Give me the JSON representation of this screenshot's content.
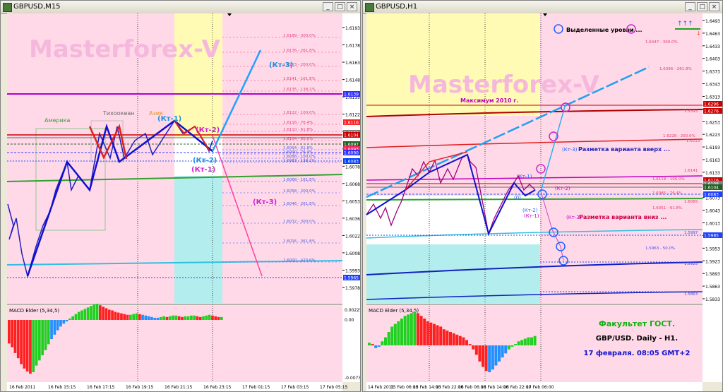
{
  "left": {
    "title": "GBPUSD,M15",
    "watermark": "Masterforex-V",
    "price_ticks": [
      "1.6193",
      "1.6178",
      "1.6163",
      "1.6148",
      "1.6135",
      "1.6122",
      "1.6108",
      "1.6093",
      "1.6078",
      "1.6068",
      "1.6053",
      "1.6036",
      "1.6022",
      "1.6008",
      "1.5993",
      "1.5978"
    ],
    "price_tags": [
      {
        "text": "1.6139",
        "color": "#3030ff"
      },
      {
        "text": "1.6116",
        "color": "#ff2020"
      },
      {
        "text": "1.6106",
        "color": "#808080"
      },
      {
        "text": "1.6104",
        "color": "#cc0000"
      },
      {
        "text": "1.6097",
        "color": "#206020"
      },
      {
        "text": "1.6093",
        "color": "#ff2060"
      },
      {
        "text": "1.6090",
        "color": "#3030ff"
      },
      {
        "text": "1.6083",
        "color": "#0040ff"
      },
      {
        "text": "1.5965",
        "color": "#2040ff"
      }
    ],
    "fib_labels": [
      "1.6189 - 300.0%",
      "1.6176 - 261.8%",
      "1.6163 - 200.0%",
      "1.6141 - 161.8%",
      "1.6135 - 138.2%",
      "1.6122 - 100.0%",
      "1.6116 - 76.4%",
      "1.6110 - 61.8%",
      "1.6104 - 50.0%",
      "1.6094 - 61.8%",
      "1.6090 - 76.4%",
      "1.6088 - 100.0%",
      "1.6083 - 138.2%",
      "1.6068 - 161.8%",
      "1.6058 - 200.0%",
      "1.6046 - 261.8%",
      "1.6032 - 300.0%",
      "1.6016 - 361.8%",
      "1.6000 - 423.6%"
    ],
    "session_labels": [
      "Америка",
      "Тихоокеан",
      "Азия"
    ],
    "annotations": {
      "kt1": "(Кт-1)",
      "kt2_top": "(Кт-2)",
      "kt3_top": "(Кт-3)",
      "kt2_bottom": "(Кт-2)",
      "kt1_bottom": "(Кт-1)",
      "kt3_bottom": "(Кт-3)"
    },
    "macd_title": "MACD Elder (5,34,5)",
    "macd_ticks": [
      "0.00225",
      "0.00",
      "-0.00735"
    ],
    "time_labels": [
      "16 Feb 2011",
      "16 Feb 15:15",
      "16 Feb 17:15",
      "16 Feb 19:15",
      "16 Feb 21:15",
      "16 Feb 23:15",
      "17 Feb 01:15",
      "17 Feb 03:15",
      "17 Feb 05:15"
    ]
  },
  "right": {
    "title": "GBPUSD,H1",
    "watermark": "Masterforex-V",
    "legend_text": "Выделенные уровни ...",
    "price_ticks": [
      "1.6493",
      "1.6463",
      "1.6433",
      "1.6403",
      "1.6373",
      "1.6343",
      "1.6313",
      "1.6283",
      "1.6253",
      "1.6223",
      "1.6193",
      "1.6163",
      "1.6133",
      "1.6103",
      "1.6073",
      "1.6043",
      "1.6013",
      "1.5983",
      "1.5953",
      "1.5923",
      "1.5893",
      "1.5863",
      "1.5833"
    ],
    "price_tags": [
      {
        "text": "1.6296",
        "color": "#cc0000"
      },
      {
        "text": "1.6276",
        "color": "#cc0000"
      },
      {
        "text": "1.6116",
        "color": "#cc0000"
      },
      {
        "text": "1.6108",
        "color": "#808080"
      },
      {
        "text": "1.6104",
        "color": "#206020"
      },
      {
        "text": "1.6083",
        "color": "#2040ff"
      },
      {
        "text": "1.5985",
        "color": "#2040ff"
      }
    ],
    "level_labels": [
      "1.6447 - 300.0%",
      "1.6396 - 261.8%",
      "1.5393",
      "1.6228 - 200.0%",
      "1.6213",
      "1.6141",
      "1.6118 - 100.0%",
      "1.6085 - 76.4%",
      "1.6065",
      "1.6051 - 61.8%",
      "1.5997",
      "1.5963 - 50.0%",
      "1.5925",
      "1.5863"
    ],
    "annotations": {
      "max2010": "Максимум 2010 г.",
      "kt3_up": "(Кт-3)",
      "up_text": "Разметка варианта вверх ...",
      "kt1": "(Кт-1)",
      "kt2": "(Кт-2)",
      "zero": "(0)",
      "kt2b": "(Кт-2)",
      "kt1b": "(Кт-1)",
      "kt3_down": "(Кт-3)",
      "down_text": "Разметка варианта вниз ..."
    },
    "info": {
      "line1": "Факультет ГОСТ.",
      "line2": "GBP/USD. Daily - H1.",
      "line3": "17 февраля. 08:05 GMT+2"
    },
    "macd_title": "MACD Elder (5,34,5)",
    "time_labels": [
      "14 Feb 2011",
      "15 Feb 06:00",
      "15 Feb 14:00",
      "15 Feb 22:00",
      "16 Feb 06:00",
      "16 Feb 14:00",
      "16 Feb 22:00",
      "17 Feb 06:00"
    ]
  }
}
